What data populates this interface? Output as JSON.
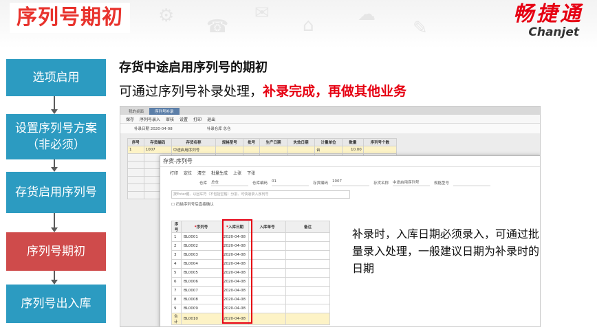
{
  "slide": {
    "title": "序列号期初",
    "logo_cn": "畅捷通",
    "logo_en": "Chanjet",
    "subtitle": "存货中途启用序列号的期初",
    "line_prefix": "可通过序列号补录处理，",
    "line_emphasis": "补录完成，再做其他业务",
    "note": "补录时，入库日期必须录入，可通过批量录入处理，一般建议日期为补录时的日期"
  },
  "flow": {
    "steps": [
      {
        "label": "选项启用",
        "active": false
      },
      {
        "label": "设置序列号方案（非必须）",
        "active": false
      },
      {
        "label": "存货启用序列号",
        "active": false
      },
      {
        "label": "序列号期初",
        "active": true
      },
      {
        "label": "序列号出入库",
        "active": false
      }
    ]
  },
  "app": {
    "tabs": [
      "我的桌面",
      "序列号补录"
    ],
    "toolbar": [
      "保存",
      "序列号录入",
      "审核",
      "设置",
      "打印",
      "退出"
    ],
    "filter_date_label": "补录日期",
    "filter_date": "2020-04-08",
    "filter_wh_label": "补录仓库",
    "filter_wh": "总仓",
    "columns": [
      "序号",
      "存货编码",
      "存货名称",
      "规格型号",
      "批号",
      "生产日期",
      "失效日期",
      "计量单位",
      "数量",
      "序列号个数"
    ],
    "row": {
      "no": "1",
      "code": "1007",
      "name": "中途启用序列号",
      "unit": "台",
      "qty": "10.00"
    },
    "total_label": "合计"
  },
  "dialog": {
    "title": "存货-序列号",
    "toolbar": [
      "打印",
      "定位",
      "清空",
      "批量生成",
      "上张",
      "下张"
    ],
    "fields": [
      {
        "label": "仓库",
        "value": "总仓"
      },
      {
        "label": "仓库编码",
        "value": "01"
      },
      {
        "label": "存货编码",
        "value": "1007"
      },
      {
        "label": "存货名称",
        "value": "中途启用序列号"
      },
      {
        "label": "规格型号",
        "value": ""
      }
    ],
    "scan_placeholder": "按Enter键、以回车符（不包括空格）分割、可快速录入序列号",
    "checkbox_label": "扫描序列号后直接确认",
    "columns": [
      "序号",
      "序列号",
      "入库日期",
      "入库单号",
      "备注"
    ],
    "rows": [
      {
        "no": "1",
        "sn": "BL0001",
        "date": "2020-04-08"
      },
      {
        "no": "2",
        "sn": "BL0002",
        "date": "2020-04-08"
      },
      {
        "no": "3",
        "sn": "BL0003",
        "date": "2020-04-08"
      },
      {
        "no": "4",
        "sn": "BL0004",
        "date": "2020-04-08"
      },
      {
        "no": "5",
        "sn": "BL0005",
        "date": "2020-04-08"
      },
      {
        "no": "6",
        "sn": "BL0006",
        "date": "2020-04-08"
      },
      {
        "no": "7",
        "sn": "BL0007",
        "date": "2020-04-08"
      },
      {
        "no": "8",
        "sn": "BL0008",
        "date": "2020-04-08"
      },
      {
        "no": "9",
        "sn": "BL0009",
        "date": "2020-04-08"
      },
      {
        "no": "10",
        "sn": "BL0010",
        "date": "2020-04-08"
      }
    ]
  }
}
